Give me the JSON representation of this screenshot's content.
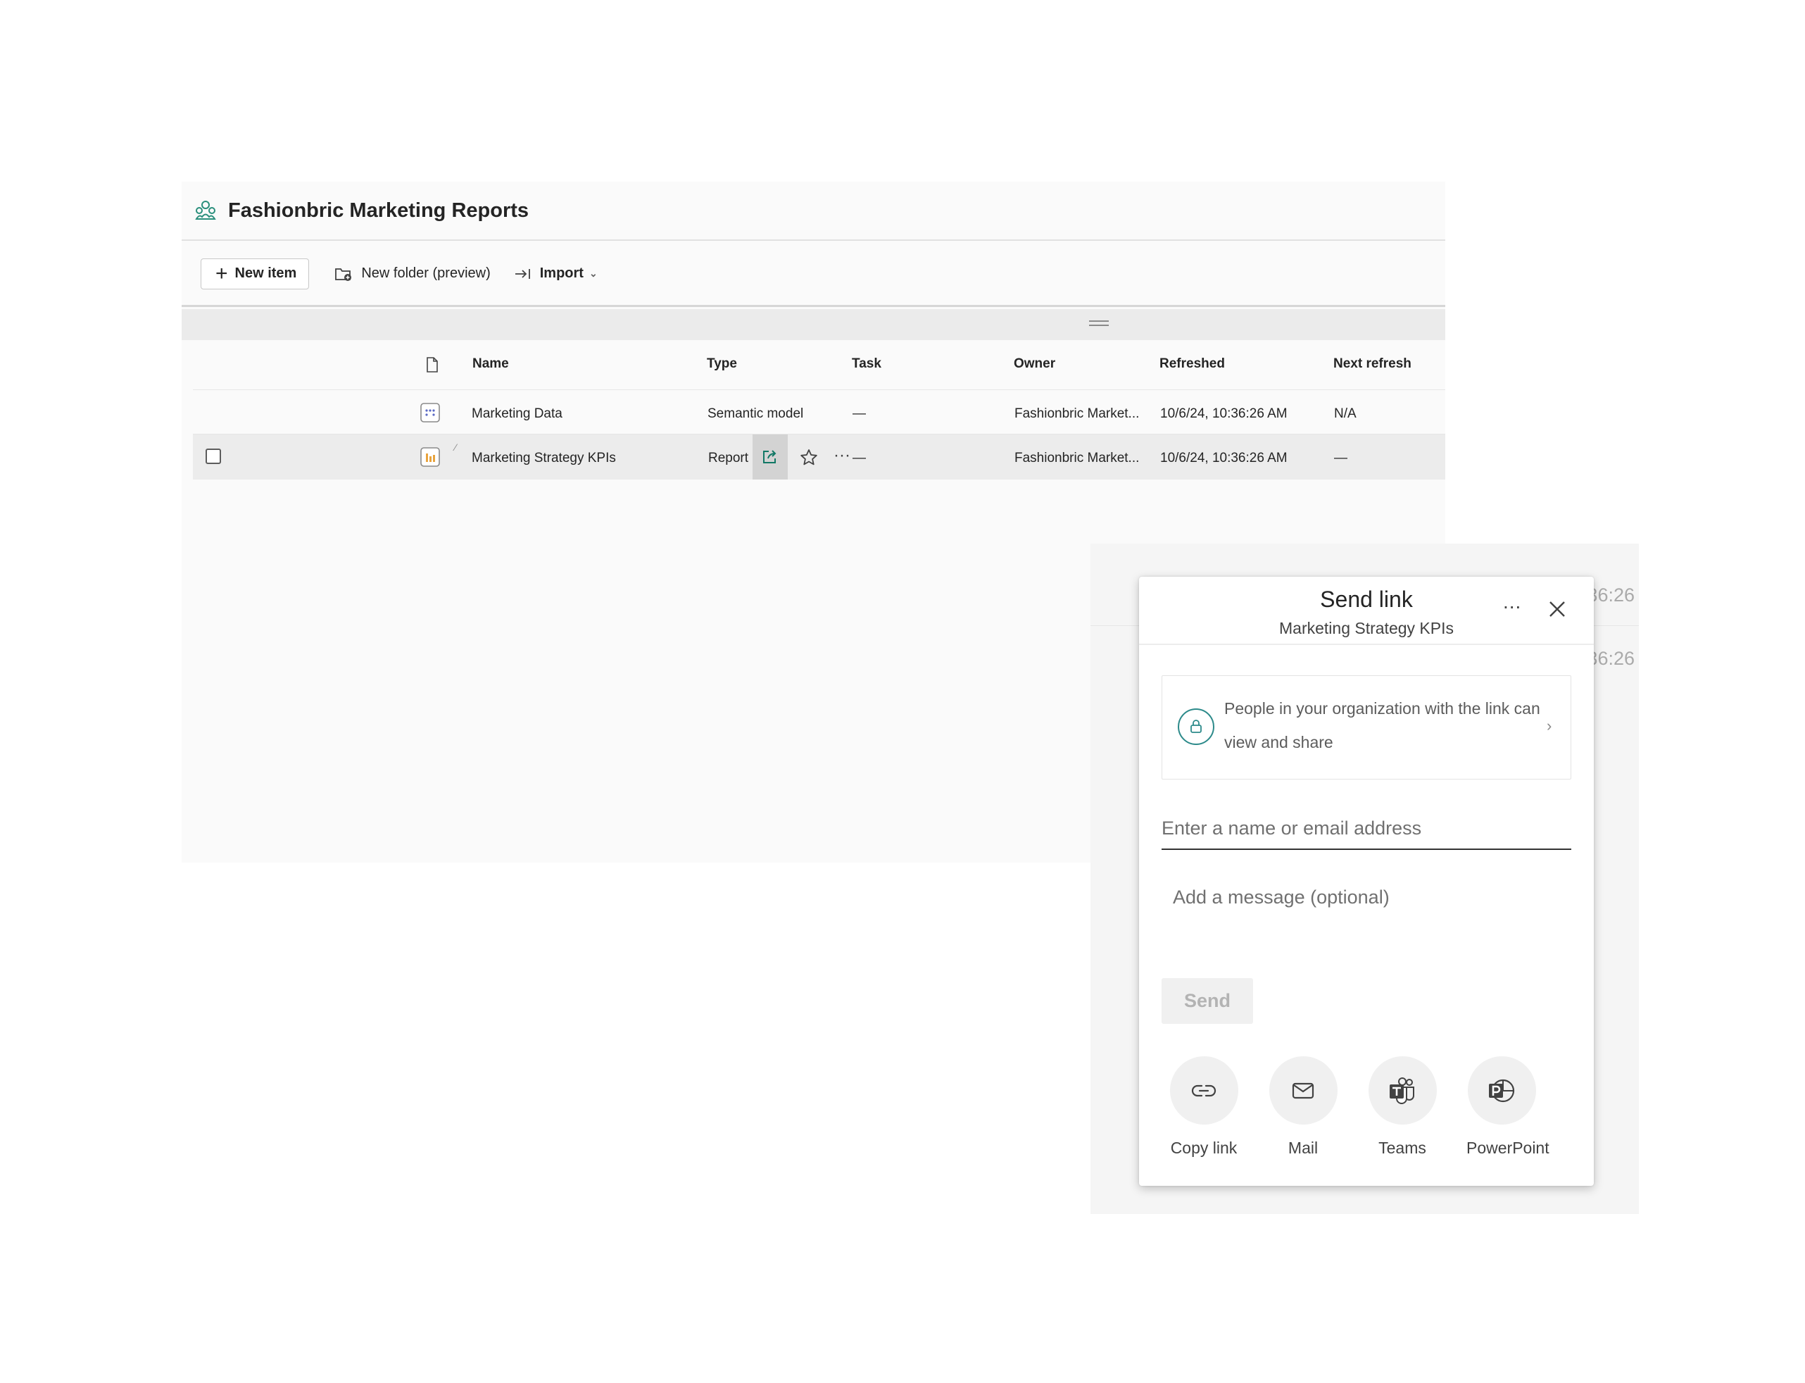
{
  "workspace": {
    "title": "Fashionbric Marketing Reports",
    "toolbar": {
      "new_item": "New item",
      "new_folder": "New folder (preview)",
      "import": "Import"
    },
    "columns": {
      "name": "Name",
      "type": "Type",
      "task": "Task",
      "owner": "Owner",
      "refreshed": "Refreshed",
      "next_refresh": "Next refresh"
    },
    "rows": [
      {
        "name": "Marketing Data",
        "type": "Semantic model",
        "task": "—",
        "owner": "Fashionbric Market...",
        "refreshed": "10/6/24, 10:36:26 AM",
        "next_refresh": "N/A"
      },
      {
        "name": "Marketing Strategy KPIs",
        "type": "Report",
        "task": "—",
        "owner": "Fashionbric Market...",
        "refreshed": "10/6/24, 10:36:26 AM",
        "next_refresh": "—"
      }
    ]
  },
  "ghost": {
    "text_1": "36:26",
    "text_2": "36:26"
  },
  "dialog": {
    "title": "Send link",
    "subtitle": "Marketing Strategy KPIs",
    "more": "...",
    "permission_text": "People in your organization with the link can view and share",
    "to_placeholder": "Enter a name or email address",
    "message_placeholder": "Add a message (optional)",
    "send": "Send",
    "options": [
      {
        "label": "Copy link",
        "icon": "link-icon"
      },
      {
        "label": "Mail",
        "icon": "mail-icon"
      },
      {
        "label": "Teams",
        "icon": "teams-icon"
      },
      {
        "label": "PowerPoint",
        "icon": "powerpoint-icon"
      }
    ]
  },
  "colors": {
    "accent": "#117865",
    "report_icon": "#e8a33d",
    "lock_ring": "#2c8a8a"
  }
}
